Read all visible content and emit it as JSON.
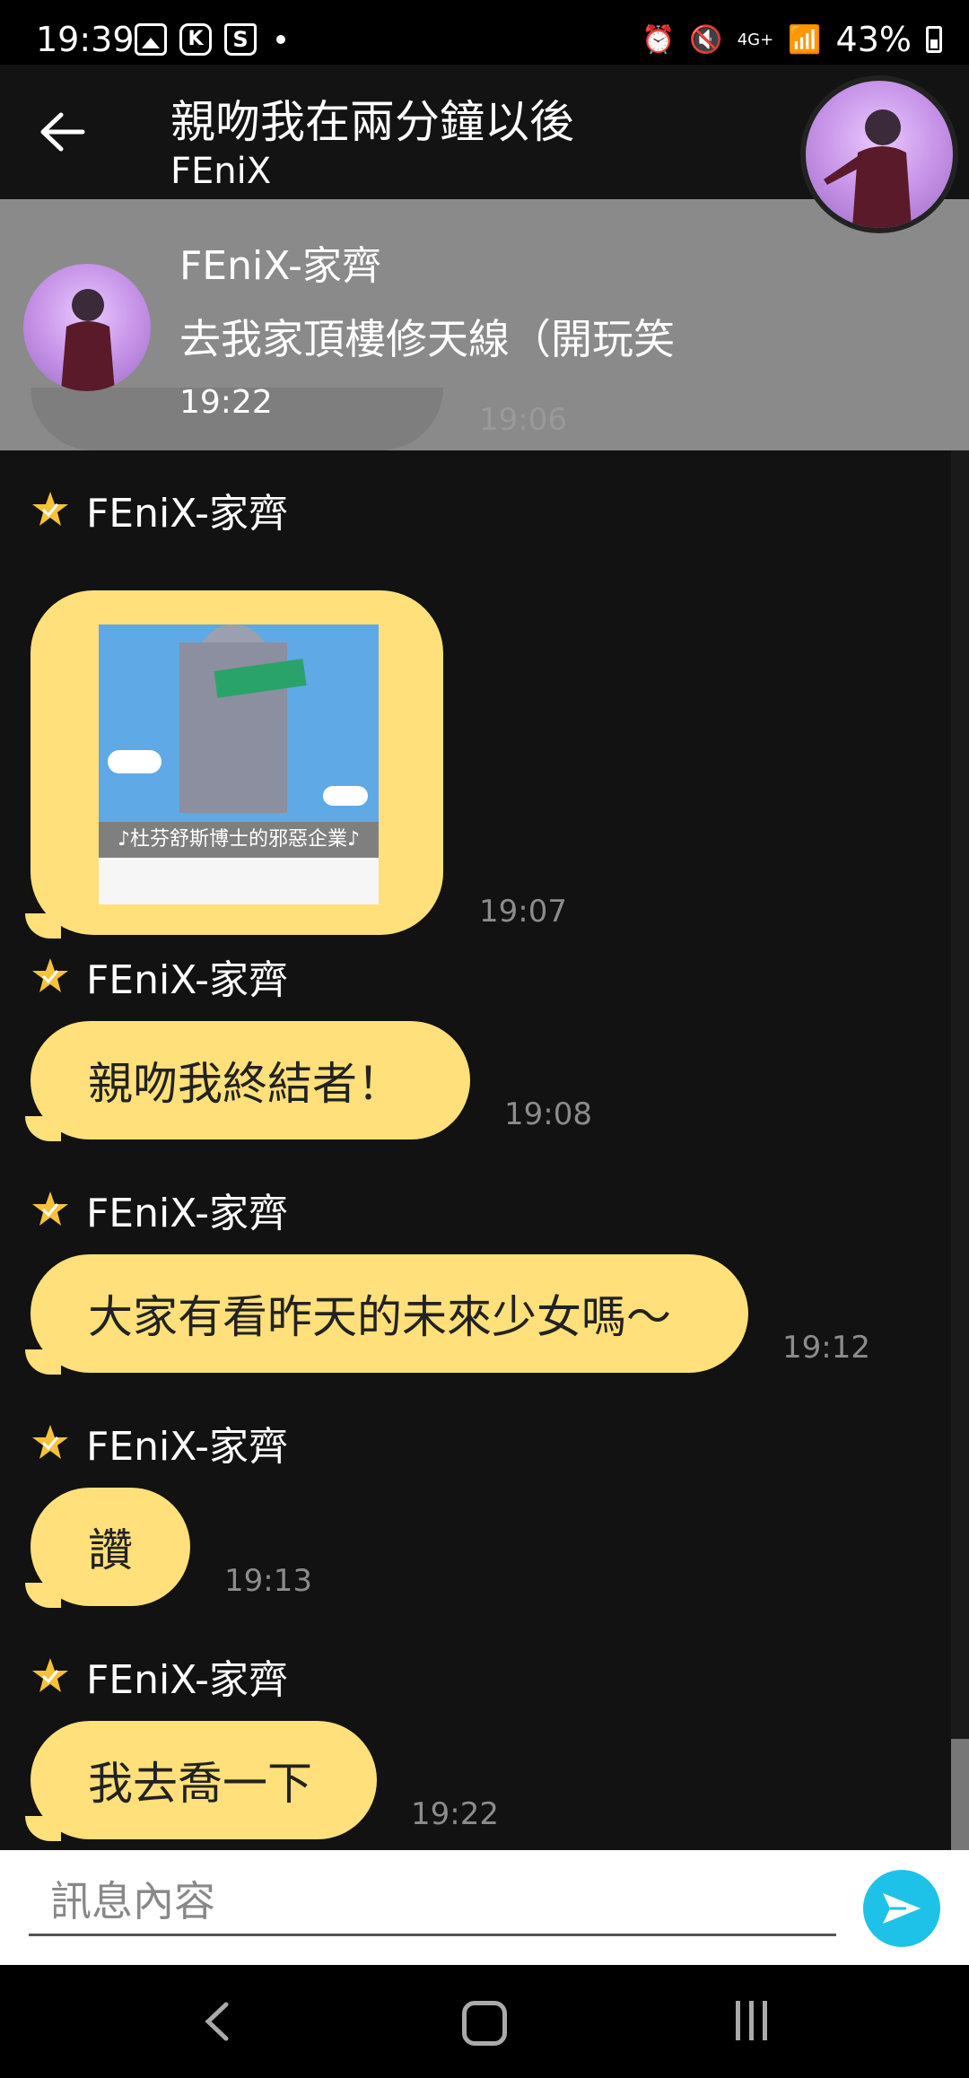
{
  "status_bar": {
    "time": "19:39",
    "battery": "43%",
    "network": "4G+"
  },
  "header": {
    "title": "親吻我在兩分鐘以後",
    "subtitle": "FEniX"
  },
  "notification": {
    "name": "FEniX-家齊",
    "text": "去我家頂樓修天線（開玩笑",
    "time": "19:22",
    "ghost_time": "19:06"
  },
  "messages": [
    {
      "sender": "FEniX-家齊",
      "type": "image",
      "image_caption": "♪杜芬舒斯博士的邪惡企業♪",
      "time": "19:07"
    },
    {
      "sender": "FEniX-家齊",
      "type": "text",
      "text": "親吻我終結者！",
      "time": "19:08"
    },
    {
      "sender": "FEniX-家齊",
      "type": "text",
      "text": "大家有看昨天的未來少女嗎～",
      "time": "19:12"
    },
    {
      "sender": "FEniX-家齊",
      "type": "text",
      "text": "讚",
      "time": "19:13"
    },
    {
      "sender": "FEniX-家齊",
      "type": "text",
      "text": "我去喬一下",
      "time": "19:22"
    }
  ],
  "input": {
    "placeholder": "訊息內容"
  },
  "colors": {
    "bubble": "#ffe07a",
    "send_button": "#1ec2e8",
    "background": "#121212",
    "notification": "#8a8a8a"
  }
}
